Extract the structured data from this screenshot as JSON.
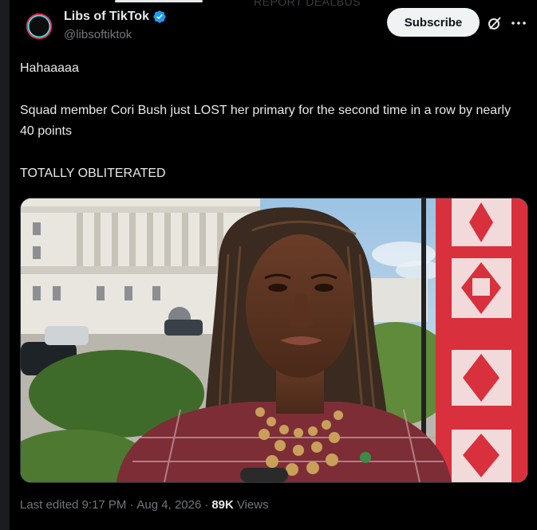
{
  "header": {
    "display_name": "Libs of TikTok",
    "handle": "@libsoftiktok",
    "avatar_text": "Libs of TikTok",
    "ghost_text": "REPORT DEALBUS",
    "subscribe_label": "Subscribe",
    "icons": [
      "verified-badge-icon",
      "grok-icon",
      "more-options-icon"
    ]
  },
  "post": {
    "lines": [
      "Hahaaaaa",
      "Squad member Cori Bush just LOST her primary for the second time in a row by nearly 40 points",
      "TOTALLY OBLITERATED"
    ],
    "image_alt": "Cori Bush standing in front of the U.S. Capitol"
  },
  "footer": {
    "edited": "Last edited 9:17 PM",
    "separator": "·",
    "date": "Aug 4, 2026",
    "views_count": "89K",
    "views_label": "Views"
  },
  "colors": {
    "background": "#000000",
    "text": "#e7e9ea",
    "muted": "#71767b",
    "verified": "#1d9bf0",
    "subscribe_bg": "#eff3f4"
  }
}
